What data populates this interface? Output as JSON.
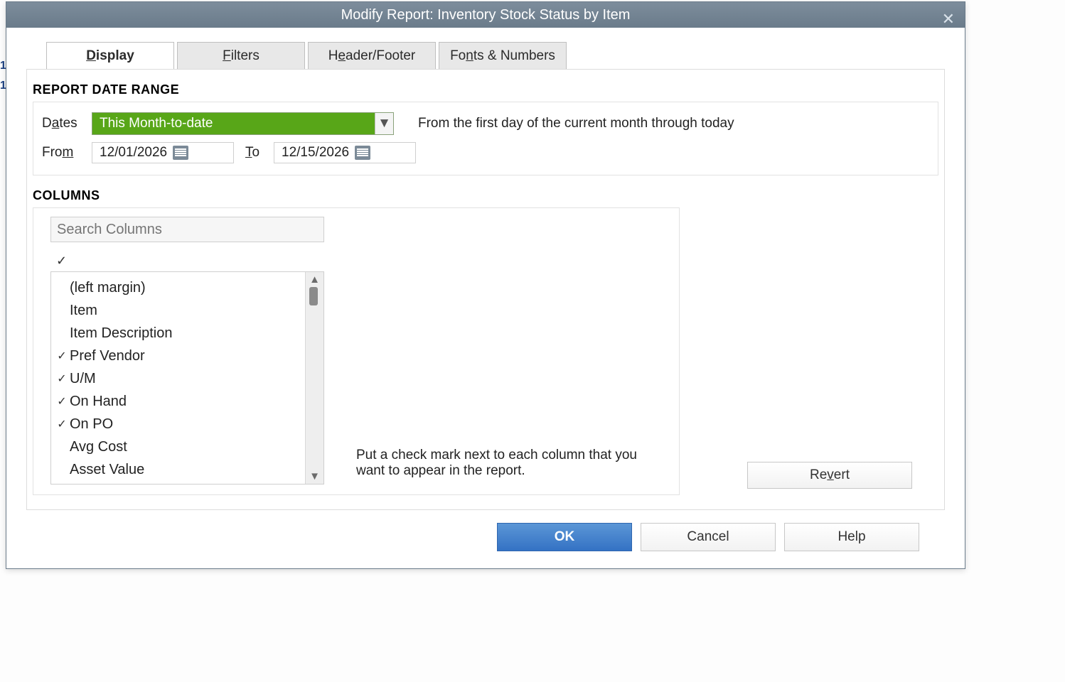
{
  "window": {
    "title": "Modify Report: Inventory Stock Status by Item"
  },
  "tabs": {
    "display": "Display",
    "display_u": "D",
    "filters": "ilters",
    "filters_u": "F",
    "header_pre": "H",
    "header_mid": "e",
    "header_post": "ader/Footer",
    "fonts_pre": "Fo",
    "fonts_mid": "n",
    "fonts_post": "ts & Numbers"
  },
  "sections": {
    "daterange": "REPORT DATE RANGE",
    "columns": "COLUMNS"
  },
  "dates": {
    "label_pre": "D",
    "label_mid": "a",
    "label_post": "tes",
    "selected": "This Month-to-date",
    "desc": "From the first day of the current month through today",
    "from_pre": "Fro",
    "from_mid": "m",
    "from_value": "12/01/2026",
    "to_pre": "T",
    "to_mid": "o",
    "to_value": "12/15/2026"
  },
  "columns": {
    "search_placeholder": "Search Columns",
    "check_header": "✓",
    "items": [
      {
        "checked": false,
        "label": "(left margin)"
      },
      {
        "checked": false,
        "label": "Item"
      },
      {
        "checked": false,
        "label": "Item Description"
      },
      {
        "checked": true,
        "label": "Pref Vendor"
      },
      {
        "checked": true,
        "label": "U/M"
      },
      {
        "checked": true,
        "label": "On Hand"
      },
      {
        "checked": true,
        "label": "On PO"
      },
      {
        "checked": false,
        "label": "Avg Cost"
      },
      {
        "checked": false,
        "label": "Asset Value"
      }
    ],
    "desc": "Put a check mark next to each column that you want to appear in the report."
  },
  "buttons": {
    "revert_pre": "Re",
    "revert_mid": "v",
    "revert_post": "ert",
    "ok": "OK",
    "cancel": "Cancel",
    "help": "Help"
  },
  "side_stubs": [
    "1",
    "1"
  ]
}
